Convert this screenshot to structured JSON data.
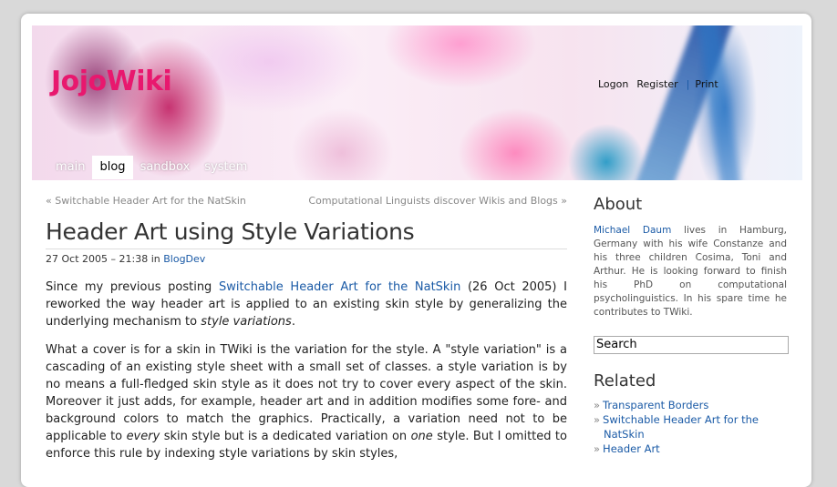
{
  "site": {
    "title": "JojoWiki"
  },
  "toplinks": {
    "logon": "Logon",
    "register": "Register",
    "separator": "|",
    "print": "Print"
  },
  "tabs": [
    {
      "label": "main",
      "active": false
    },
    {
      "label": "blog",
      "active": true
    },
    {
      "label": "sandbox",
      "active": false
    },
    {
      "label": "system",
      "active": false
    }
  ],
  "post": {
    "prev": "« Switchable Header Art for the NatSkin",
    "next": "Computational Linguists discover Wikis and Blogs »",
    "title": "Header Art using Style Variations",
    "date": "27 Oct 2005 – 21:38 in",
    "category": "BlogDev",
    "p1_start": "Since my previous posting",
    "p1_link": "Switchable Header Art for the NatSkin",
    "p1_mid": "(26 Oct 2005) I reworked the way header art is applied to an existing skin style by generalizing the underlying mechanism to",
    "p1_em": "style variations",
    "p1_end": ".",
    "p2_a": "What a cover is for a skin in TWiki is the variation for the style. A \"style variation\" is a cascading of an existing style sheet with a small set of classes. a style variation is by no means a full-fledged skin style as it does not try to cover every aspect of the skin. Moreover it just adds, for example, header art and in addition modifies some fore- and background colors to match the graphics. Practically, a variation need not to be applicable to",
    "p2_em1": "every",
    "p2_b": "skin style but is a dedicated variation on",
    "p2_em2": "one",
    "p2_c": "style. But I omitted to enforce this rule by indexing style variations by skin styles,"
  },
  "sidebar": {
    "about_heading": "About",
    "about_name": "Michael Daum",
    "about_text": "lives in Hamburg, Germany with his wife Constanze and his three children Cosima, Toni and Arthur. He is looking forward to finish his PhD on computational psycholinguistics. In his spare time he contributes to TWiki.",
    "search_value": "Search",
    "related_heading": "Related",
    "related": [
      "Transparent Borders",
      "Switchable Header Art for the NatSkin",
      "Header Art"
    ],
    "bullet": "»"
  },
  "colors": {
    "title": "#e8186e",
    "link": "#1a5aa6"
  },
  "icons": {
    "related_bullet": "double-angle-bullet"
  }
}
